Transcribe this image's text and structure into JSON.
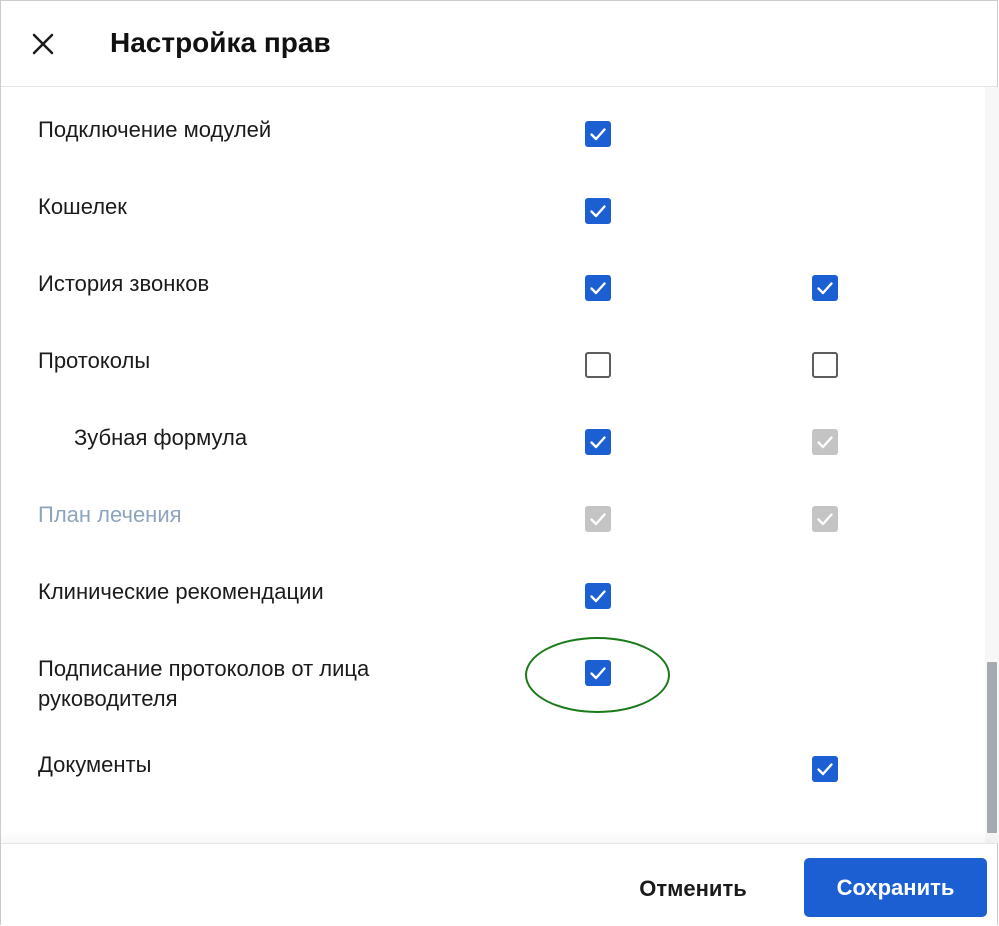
{
  "dialog": {
    "title": "Настройка прав",
    "close_icon": "close-icon"
  },
  "colors": {
    "accent": "#1b5fd3",
    "disabled_check": "#c4c4c4",
    "muted_text": "#8ea4bd",
    "highlight": "#1a7a1a"
  },
  "permissions": [
    {
      "label": "Подключение модулей",
      "col1": "checked",
      "col2": "none"
    },
    {
      "label": "Кошелек",
      "col1": "checked",
      "col2": "none"
    },
    {
      "label": "История звонков",
      "col1": "checked",
      "col2": "checked"
    },
    {
      "label": "Протоколы",
      "col1": "unchecked",
      "col2": "unchecked"
    },
    {
      "label": "Зубная формула",
      "col1": "checked",
      "col2": "disabled-checked"
    },
    {
      "label": "План лечения",
      "col1": "disabled-checked",
      "col2": "disabled-checked"
    },
    {
      "label": "Клинические рекомендации",
      "col1": "checked",
      "col2": "none"
    },
    {
      "label": "Подписание протоколов от лица руководителя",
      "col1": "checked",
      "col2": "none"
    },
    {
      "label": "Документы",
      "col1": "none",
      "col2": "checked"
    }
  ],
  "footer": {
    "cancel_label": "Отменить",
    "save_label": "Сохранить"
  }
}
